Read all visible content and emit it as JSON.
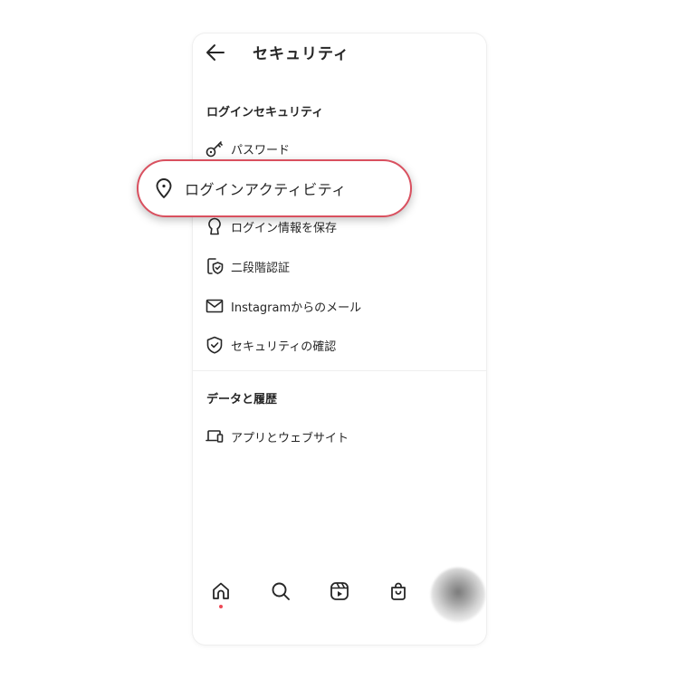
{
  "header": {
    "title": "セキュリティ",
    "back_icon": "arrow-left-icon"
  },
  "login_security": {
    "heading": "ログインセキュリティ",
    "items": [
      {
        "label": "パスワード",
        "icon": "key-icon"
      },
      {
        "label": "ログインアクティビティ",
        "icon": "location-pin-icon"
      },
      {
        "label": "ログイン情報を保存",
        "icon": "keyhole-icon"
      },
      {
        "label": "二段階認証",
        "icon": "phone-shield-icon"
      },
      {
        "label": "Instagramからのメール",
        "icon": "mail-icon"
      },
      {
        "label": "セキュリティの確認",
        "icon": "shield-check-icon"
      }
    ]
  },
  "data_history": {
    "heading": "データと履歴",
    "items": [
      {
        "label": "アプリとウェブサイト",
        "icon": "devices-icon"
      }
    ]
  },
  "bottom_nav": {
    "items": [
      "home-icon",
      "search-icon",
      "reels-icon",
      "shop-icon",
      "profile-avatar"
    ],
    "active": "home-icon",
    "notification_dot_color": "#ed4956"
  },
  "highlight_color": "#d9505f"
}
